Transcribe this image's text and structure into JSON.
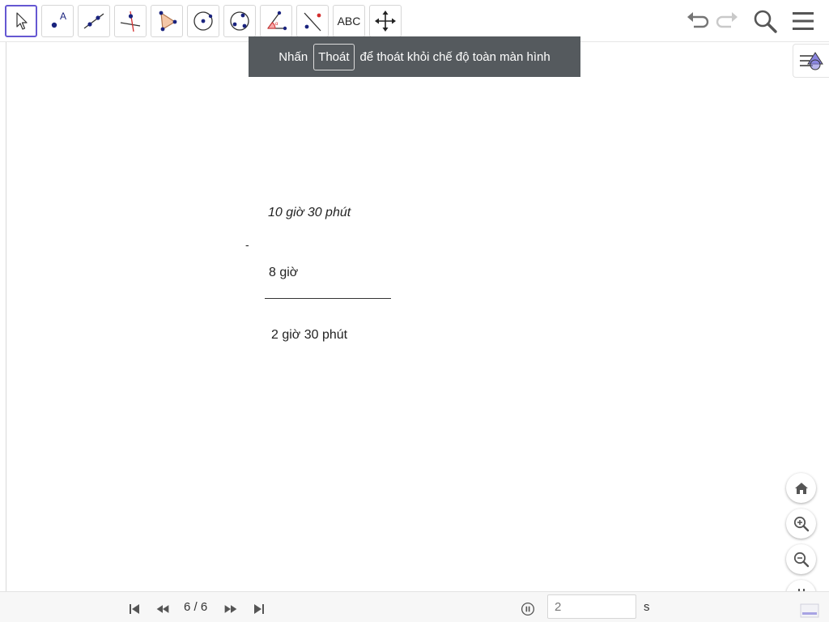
{
  "toolbar": {
    "tools": [
      {
        "name": "move-tool",
        "label": ""
      },
      {
        "name": "point-tool",
        "label": "A"
      },
      {
        "name": "line-tool",
        "label": ""
      },
      {
        "name": "perpendicular-line-tool",
        "label": ""
      },
      {
        "name": "polygon-tool",
        "label": ""
      },
      {
        "name": "circle-center-point-tool",
        "label": ""
      },
      {
        "name": "circle-three-points-tool",
        "label": ""
      },
      {
        "name": "angle-tool",
        "label": ""
      },
      {
        "name": "reflect-tool",
        "label": ""
      },
      {
        "name": "text-tool",
        "label": "ABC"
      },
      {
        "name": "move-graphics-view-tool",
        "label": ""
      }
    ],
    "icons": {
      "undo": "undo-icon",
      "redo": "redo-icon",
      "search": "search-icon",
      "menu": "menu-icon"
    },
    "active_color": "#6557d2"
  },
  "banner": {
    "before": "Nhấn",
    "key": "Thoát",
    "after": "để thoát khỏi chế độ toàn màn hình",
    "background": "#555a5e"
  },
  "canvas": {
    "minuend": "10 giờ 30 phút",
    "minus_sign": "-",
    "subtrahend": "8 giờ",
    "result": "2 giờ 30 phút"
  },
  "zoom_controls": {
    "home": "home-icon",
    "zoom_in": "zoom-in-icon",
    "zoom_out": "zoom-out-icon",
    "exit_fullscreen": "exit-fullscreen-icon"
  },
  "playback": {
    "page_indicator": "6 / 6",
    "speed_value": "2",
    "speed_unit": "s"
  }
}
